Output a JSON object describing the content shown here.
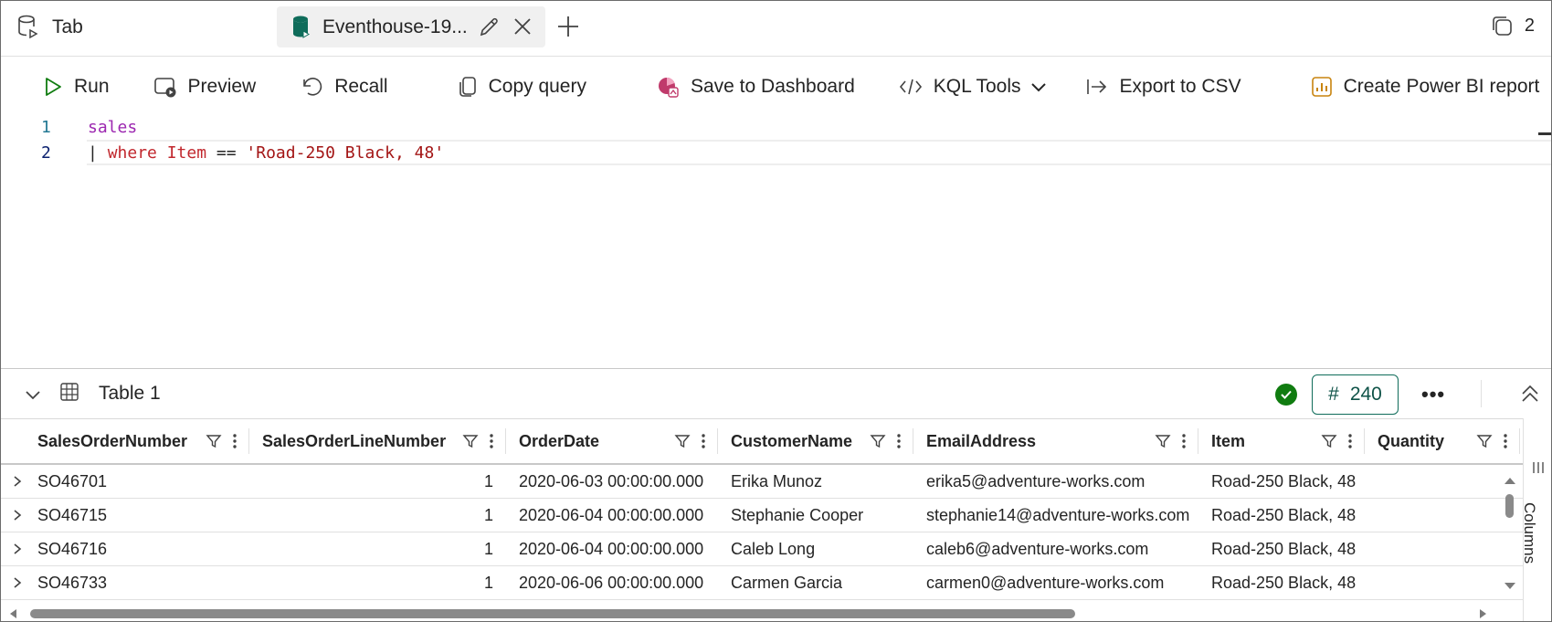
{
  "tabs": [
    {
      "label": "Tab",
      "icon": "database-query-icon"
    },
    {
      "label": "Eventhouse-19...",
      "icon": "eventhouse-database-icon"
    }
  ],
  "tab_count": "2",
  "toolbar": {
    "run": "Run",
    "preview": "Preview",
    "recall": "Recall",
    "copy_query": "Copy query",
    "save_to_dashboard": "Save to Dashboard",
    "kql_tools": "KQL Tools",
    "export_csv": "Export to CSV",
    "create_power_bi": "Create Power BI report"
  },
  "editor": {
    "lines": [
      {
        "number": "1",
        "tokens": [
          "sales"
        ]
      },
      {
        "number": "2",
        "tokens": [
          "| ",
          "where",
          " Item",
          " == ",
          "'Road-250 Black, 48'"
        ]
      }
    ]
  },
  "results": {
    "title": "Table 1",
    "row_count_symbol": "#",
    "row_count": "240",
    "more": "•••",
    "columns_panel_label": "Columns",
    "columns": [
      "SalesOrderNumber",
      "SalesOrderLineNumber",
      "OrderDate",
      "CustomerName",
      "EmailAddress",
      "Item",
      "Quantity"
    ],
    "rows": [
      [
        "SO46701",
        "1",
        "2020-06-03 00:00:00.000",
        "Erika Munoz",
        "erika5@adventure-works.com",
        "Road-250 Black, 48",
        ""
      ],
      [
        "SO46715",
        "1",
        "2020-06-04 00:00:00.000",
        "Stephanie Cooper",
        "stephanie14@adventure-works.com",
        "Road-250 Black, 48",
        ""
      ],
      [
        "SO46716",
        "1",
        "2020-06-04 00:00:00.000",
        "Caleb Long",
        "caleb6@adventure-works.com",
        "Road-250 Black, 48",
        ""
      ],
      [
        "SO46733",
        "1",
        "2020-06-06 00:00:00.000",
        "Carmen Garcia",
        "carmen0@adventure-works.com",
        "Road-250 Black, 48",
        ""
      ]
    ]
  },
  "colors": {
    "accent_teal": "#0f6c5a",
    "success_green": "#107c10",
    "keyword_purple": "#9c27b0",
    "keyword_red": "#c1272d",
    "string_red": "#a31515",
    "line_number_blue": "#237893"
  }
}
